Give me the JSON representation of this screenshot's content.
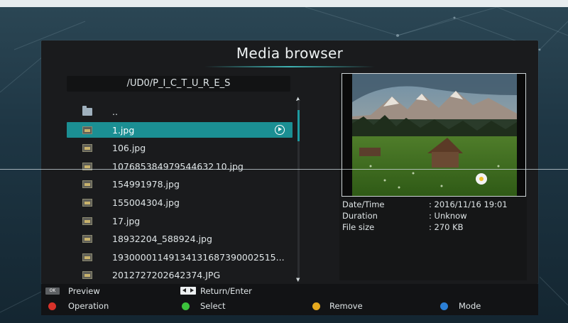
{
  "title": "Media browser",
  "path": "/UD0/P_I_C_T_U_R_E_S",
  "files": [
    {
      "name": "..",
      "type": "folder"
    },
    {
      "name": "1.jpg",
      "type": "image",
      "selected": true
    },
    {
      "name": "106.jpg",
      "type": "image"
    },
    {
      "name": "107685384979544632 10.jpg",
      "type": "image"
    },
    {
      "name": "154991978.jpg",
      "type": "image"
    },
    {
      "name": "155004304.jpg",
      "type": "image"
    },
    {
      "name": "17.jpg",
      "type": "image"
    },
    {
      "name": "18932204_588924.jpg",
      "type": "image"
    },
    {
      "name": "19300001149134131687390002515...",
      "type": "image"
    },
    {
      "name": "2012727202642374.JPG",
      "type": "image"
    }
  ],
  "info": [
    {
      "key": "Date/Time",
      "value": ": 2016/11/16 19:01"
    },
    {
      "key": "Duration",
      "value": ": Unknow"
    },
    {
      "key": "File size",
      "value": ": 270 KB"
    }
  ],
  "footer": {
    "ok_key": "OK",
    "preview": "Preview",
    "return_enter": "Return/Enter",
    "operation": "Operation",
    "select": "Select",
    "remove": "Remove",
    "mode": "Mode"
  },
  "colors": {
    "accent": "#1b8f93",
    "red": "#d8322a",
    "green": "#3cc23c",
    "yellow": "#e6a91e",
    "blue": "#2b7fd6"
  },
  "icons": {
    "folder": "folder-icon",
    "image": "image-file-icon",
    "play": "play-circle-icon"
  }
}
